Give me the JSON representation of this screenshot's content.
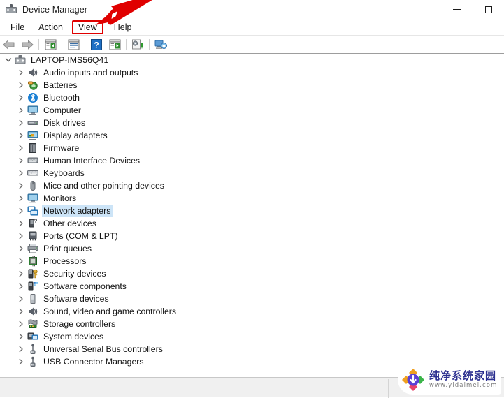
{
  "window": {
    "title": "Device Manager",
    "icon": "device-manager-icon",
    "controls": [
      {
        "name": "minimize-button",
        "glyph": "minimize"
      },
      {
        "name": "maximize-button",
        "glyph": "maximize"
      }
    ]
  },
  "menubar": {
    "items": [
      {
        "label": "File",
        "highlighted": false
      },
      {
        "label": "Action",
        "highlighted": false
      },
      {
        "label": "View",
        "highlighted": true
      },
      {
        "label": "Help",
        "highlighted": false
      }
    ]
  },
  "toolbar": {
    "buttons": [
      {
        "name": "back-button",
        "icon": "back-arrow-icon"
      },
      {
        "name": "forward-button",
        "icon": "forward-arrow-icon"
      },
      {
        "name": "separator-1",
        "icon": "separator"
      },
      {
        "name": "show-hide-console-tree-button",
        "icon": "console-tree-icon"
      },
      {
        "name": "separator-2",
        "icon": "separator"
      },
      {
        "name": "properties-button",
        "icon": "properties-icon"
      },
      {
        "name": "separator-3",
        "icon": "separator"
      },
      {
        "name": "help-button",
        "icon": "help-question-icon"
      },
      {
        "name": "scan-hardware-changes-button",
        "icon": "scan-hardware-icon"
      },
      {
        "name": "separator-4",
        "icon": "separator"
      },
      {
        "name": "update-driver-button",
        "icon": "update-driver-icon"
      },
      {
        "name": "separator-5",
        "icon": "separator"
      },
      {
        "name": "remote-desktop-button",
        "icon": "remote-computer-icon"
      }
    ]
  },
  "tree": {
    "root": {
      "label": "LAPTOP-IMS56Q41",
      "icon": "computer-root-icon",
      "expanded": true
    },
    "items": [
      {
        "label": "Audio inputs and outputs",
        "icon": "speaker-icon",
        "selected": false
      },
      {
        "label": "Batteries",
        "icon": "battery-icon",
        "selected": false
      },
      {
        "label": "Bluetooth",
        "icon": "bluetooth-icon",
        "selected": false
      },
      {
        "label": "Computer",
        "icon": "monitor-icon",
        "selected": false
      },
      {
        "label": "Disk drives",
        "icon": "disk-drive-icon",
        "selected": false
      },
      {
        "label": "Display adapters",
        "icon": "display-adapter-icon",
        "selected": false
      },
      {
        "label": "Firmware",
        "icon": "firmware-chip-icon",
        "selected": false
      },
      {
        "label": "Human Interface Devices",
        "icon": "hid-icon",
        "selected": false
      },
      {
        "label": "Keyboards",
        "icon": "keyboard-icon",
        "selected": false
      },
      {
        "label": "Mice and other pointing devices",
        "icon": "mouse-icon",
        "selected": false
      },
      {
        "label": "Monitors",
        "icon": "monitor-icon",
        "selected": false
      },
      {
        "label": "Network adapters",
        "icon": "network-adapter-icon",
        "selected": true
      },
      {
        "label": "Other devices",
        "icon": "unknown-device-icon",
        "selected": false
      },
      {
        "label": "Ports (COM & LPT)",
        "icon": "port-icon",
        "selected": false
      },
      {
        "label": "Print queues",
        "icon": "printer-icon",
        "selected": false
      },
      {
        "label": "Processors",
        "icon": "processor-icon",
        "selected": false
      },
      {
        "label": "Security devices",
        "icon": "security-key-icon",
        "selected": false
      },
      {
        "label": "Software components",
        "icon": "software-component-icon",
        "selected": false
      },
      {
        "label": "Software devices",
        "icon": "software-device-icon",
        "selected": false
      },
      {
        "label": "Sound, video and game controllers",
        "icon": "speaker-icon",
        "selected": false
      },
      {
        "label": "Storage controllers",
        "icon": "storage-controller-icon",
        "selected": false
      },
      {
        "label": "System devices",
        "icon": "system-device-icon",
        "selected": false
      },
      {
        "label": "Universal Serial Bus controllers",
        "icon": "usb-icon",
        "selected": false
      },
      {
        "label": "USB Connector Managers",
        "icon": "usb-icon",
        "selected": false
      }
    ]
  },
  "statusbar": {
    "text": ""
  },
  "annotations": {
    "arrow": {
      "name": "red-pointer-arrow",
      "color": "#e00000"
    },
    "box": {
      "name": "view-menu-highlight-box",
      "color": "#e00000"
    }
  },
  "watermark": {
    "title": "纯净系统家园",
    "url": "www.yidaimei.com"
  }
}
